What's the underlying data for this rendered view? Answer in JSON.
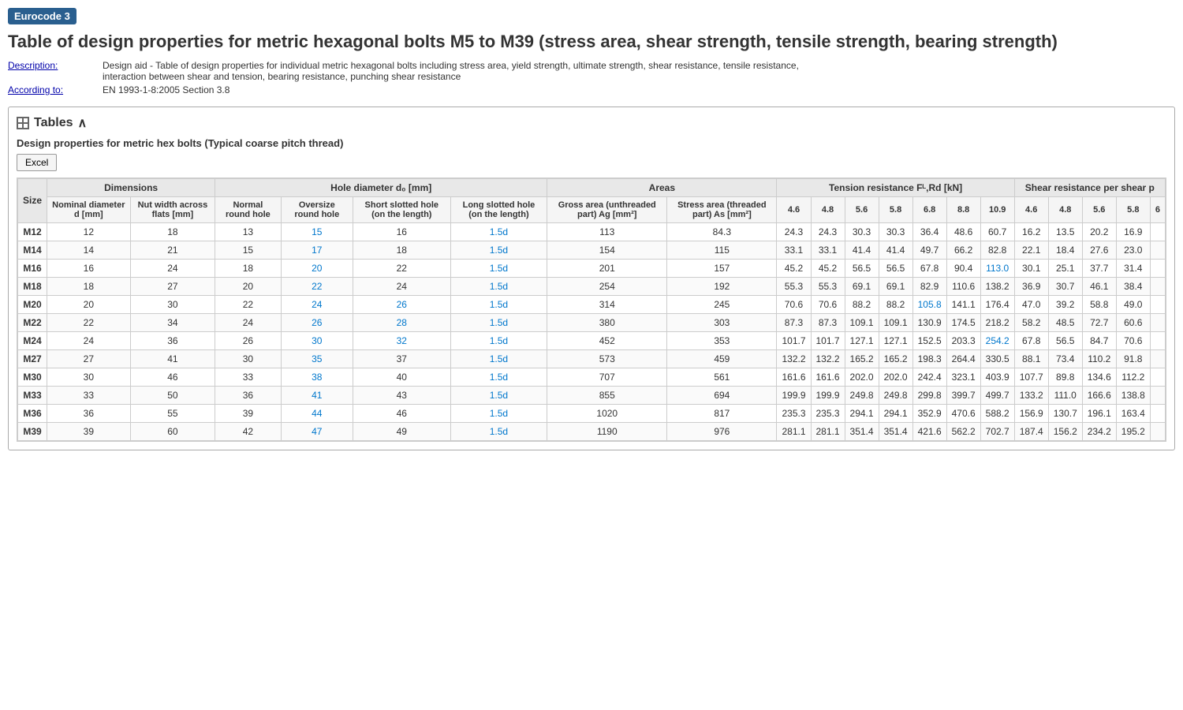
{
  "badge": "Eurocode 3",
  "title": "Table of design properties for metric hexagonal bolts M5 to M39 (stress area, shear strength, tensile strength, bearing strength)",
  "meta": {
    "description_label": "Description:",
    "description_value": "Design aid - Table of design properties for individual metric hexagonal bolts including stress area, yield strength, ultimate strength, shear resistance, tensile resistance, interaction between shear and tension, bearing resistance, punching shear resistance",
    "according_label": "According to:",
    "according_value": "EN 1993-1-8:2005 Section 3.8"
  },
  "tables_header": "Tables",
  "table_subtitle": "Design properties for metric hex bolts (Typical coarse pitch thread)",
  "excel_button": "Excel",
  "headers": {
    "dimensions": "Dimensions",
    "hole_diameter": "Hole diameter d₀ [mm]",
    "areas": "Areas",
    "tension": "Tension resistance Fᴸ,Rd [kN]",
    "shear": "Shear resistance per shear p"
  },
  "sub_headers": {
    "size": "Size",
    "nominal_dia": "Nominal diameter d [mm]",
    "nut_width": "Nut width across flats [mm]",
    "normal_hole": "Normal round hole",
    "oversize_hole": "Oversize round hole",
    "short_slotted": "Short slotted hole (on the length)",
    "long_slotted": "Long slotted hole (on the length)",
    "gross_area": "Gross area (unthreaded part) Ag [mm²]",
    "stress_area": "Stress area (threaded part) As [mm²]",
    "tension_46": "4.6",
    "tension_48": "4.8",
    "tension_56": "5.6",
    "tension_58": "5.8",
    "tension_68": "6.8",
    "tension_88": "8.8",
    "tension_109": "10.9",
    "shear_46": "4.6",
    "shear_48": "4.8",
    "shear_56": "5.6",
    "shear_58": "5.8",
    "shear_6": "6"
  },
  "rows": [
    {
      "size": "M12",
      "nom_dia": "12",
      "nut": "18",
      "normal": "13",
      "oversize": "15",
      "short": "16",
      "long": "1.5d",
      "gross": "113",
      "stress": "84.3",
      "t46": "24.3",
      "t48": "24.3",
      "t56": "30.3",
      "t58": "30.3",
      "t68": "36.4",
      "t88": "48.6",
      "t109": "60.7",
      "s46": "16.2",
      "s48": "13.5",
      "s56": "20.2",
      "s58": "16.9"
    },
    {
      "size": "M14",
      "nom_dia": "14",
      "nut": "21",
      "normal": "15",
      "oversize": "17",
      "short": "18",
      "long": "1.5d",
      "gross": "154",
      "stress": "115",
      "t46": "33.1",
      "t48": "33.1",
      "t56": "41.4",
      "t58": "41.4",
      "t68": "49.7",
      "t88": "66.2",
      "t109": "82.8",
      "s46": "22.1",
      "s48": "18.4",
      "s56": "27.6",
      "s58": "23.0"
    },
    {
      "size": "M16",
      "nom_dia": "16",
      "nut": "24",
      "normal": "18",
      "oversize": "20",
      "short": "22",
      "long": "1.5d",
      "gross": "201",
      "stress": "157",
      "t46": "45.2",
      "t48": "45.2",
      "t56": "56.5",
      "t58": "56.5",
      "t68": "67.8",
      "t88": "90.4",
      "t109": "113.0",
      "s46": "30.1",
      "s48": "25.1",
      "s56": "37.7",
      "s58": "31.4"
    },
    {
      "size": "M18",
      "nom_dia": "18",
      "nut": "27",
      "normal": "20",
      "oversize": "22",
      "short": "24",
      "long": "1.5d",
      "gross": "254",
      "stress": "192",
      "t46": "55.3",
      "t48": "55.3",
      "t56": "69.1",
      "t58": "69.1",
      "t68": "82.9",
      "t88": "110.6",
      "t109": "138.2",
      "s46": "36.9",
      "s48": "30.7",
      "s56": "46.1",
      "s58": "38.4"
    },
    {
      "size": "M20",
      "nom_dia": "20",
      "nut": "30",
      "normal": "22",
      "oversize": "24",
      "short": "26",
      "long": "1.5d",
      "gross": "314",
      "stress": "245",
      "t46": "70.6",
      "t48": "70.6",
      "t56": "88.2",
      "t58": "88.2",
      "t68": "105.8",
      "t88": "141.1",
      "t109": "176.4",
      "s46": "47.0",
      "s48": "39.2",
      "s56": "58.8",
      "s58": "49.0"
    },
    {
      "size": "M22",
      "nom_dia": "22",
      "nut": "34",
      "normal": "24",
      "oversize": "26",
      "short": "28",
      "long": "1.5d",
      "gross": "380",
      "stress": "303",
      "t46": "87.3",
      "t48": "87.3",
      "t56": "109.1",
      "t58": "109.1",
      "t68": "130.9",
      "t88": "174.5",
      "t109": "218.2",
      "s46": "58.2",
      "s48": "48.5",
      "s56": "72.7",
      "s58": "60.6"
    },
    {
      "size": "M24",
      "nom_dia": "24",
      "nut": "36",
      "normal": "26",
      "oversize": "30",
      "short": "32",
      "long": "1.5d",
      "gross": "452",
      "stress": "353",
      "t46": "101.7",
      "t48": "101.7",
      "t56": "127.1",
      "t58": "127.1",
      "t68": "152.5",
      "t88": "203.3",
      "t109": "254.2",
      "s46": "67.8",
      "s48": "56.5",
      "s56": "84.7",
      "s58": "70.6"
    },
    {
      "size": "M27",
      "nom_dia": "27",
      "nut": "41",
      "normal": "30",
      "oversize": "35",
      "short": "37",
      "long": "1.5d",
      "gross": "573",
      "stress": "459",
      "t46": "132.2",
      "t48": "132.2",
      "t56": "165.2",
      "t58": "165.2",
      "t68": "198.3",
      "t88": "264.4",
      "t109": "330.5",
      "s46": "88.1",
      "s48": "73.4",
      "s56": "110.2",
      "s58": "91.8"
    },
    {
      "size": "M30",
      "nom_dia": "30",
      "nut": "46",
      "normal": "33",
      "oversize": "38",
      "short": "40",
      "long": "1.5d",
      "gross": "707",
      "stress": "561",
      "t46": "161.6",
      "t48": "161.6",
      "t56": "202.0",
      "t58": "202.0",
      "t68": "242.4",
      "t88": "323.1",
      "t109": "403.9",
      "s46": "107.7",
      "s48": "89.8",
      "s56": "134.6",
      "s58": "112.2"
    },
    {
      "size": "M33",
      "nom_dia": "33",
      "nut": "50",
      "normal": "36",
      "oversize": "41",
      "short": "43",
      "long": "1.5d",
      "gross": "855",
      "stress": "694",
      "t46": "199.9",
      "t48": "199.9",
      "t56": "249.8",
      "t58": "249.8",
      "t68": "299.8",
      "t88": "399.7",
      "t109": "499.7",
      "s46": "133.2",
      "s48": "111.0",
      "s56": "166.6",
      "s58": "138.8"
    },
    {
      "size": "M36",
      "nom_dia": "36",
      "nut": "55",
      "normal": "39",
      "oversize": "44",
      "short": "46",
      "long": "1.5d",
      "gross": "1020",
      "stress": "817",
      "t46": "235.3",
      "t48": "235.3",
      "t56": "294.1",
      "t58": "294.1",
      "t68": "352.9",
      "t88": "470.6",
      "t109": "588.2",
      "s46": "156.9",
      "s48": "130.7",
      "s56": "196.1",
      "s58": "163.4"
    },
    {
      "size": "M39",
      "nom_dia": "39",
      "nut": "60",
      "normal": "42",
      "oversize": "47",
      "short": "49",
      "long": "1.5d",
      "gross": "1190",
      "stress": "976",
      "t46": "281.1",
      "t48": "281.1",
      "t56": "351.4",
      "t58": "351.4",
      "t68": "421.6",
      "t88": "562.2",
      "t109": "702.7",
      "s46": "187.4",
      "s48": "156.2",
      "s56": "234.2",
      "s58": "195.2"
    }
  ],
  "blue_cells": {
    "t109_blue": [
      "M16",
      "M24"
    ],
    "t68_blue": [
      "M20"
    ],
    "oversize_blue": [
      "M12",
      "M14",
      "M16",
      "M18",
      "M20",
      "M22",
      "M24",
      "M27",
      "M30",
      "M33",
      "M36",
      "M39"
    ],
    "short_blue": [
      "M20",
      "M22",
      "M24"
    ]
  }
}
